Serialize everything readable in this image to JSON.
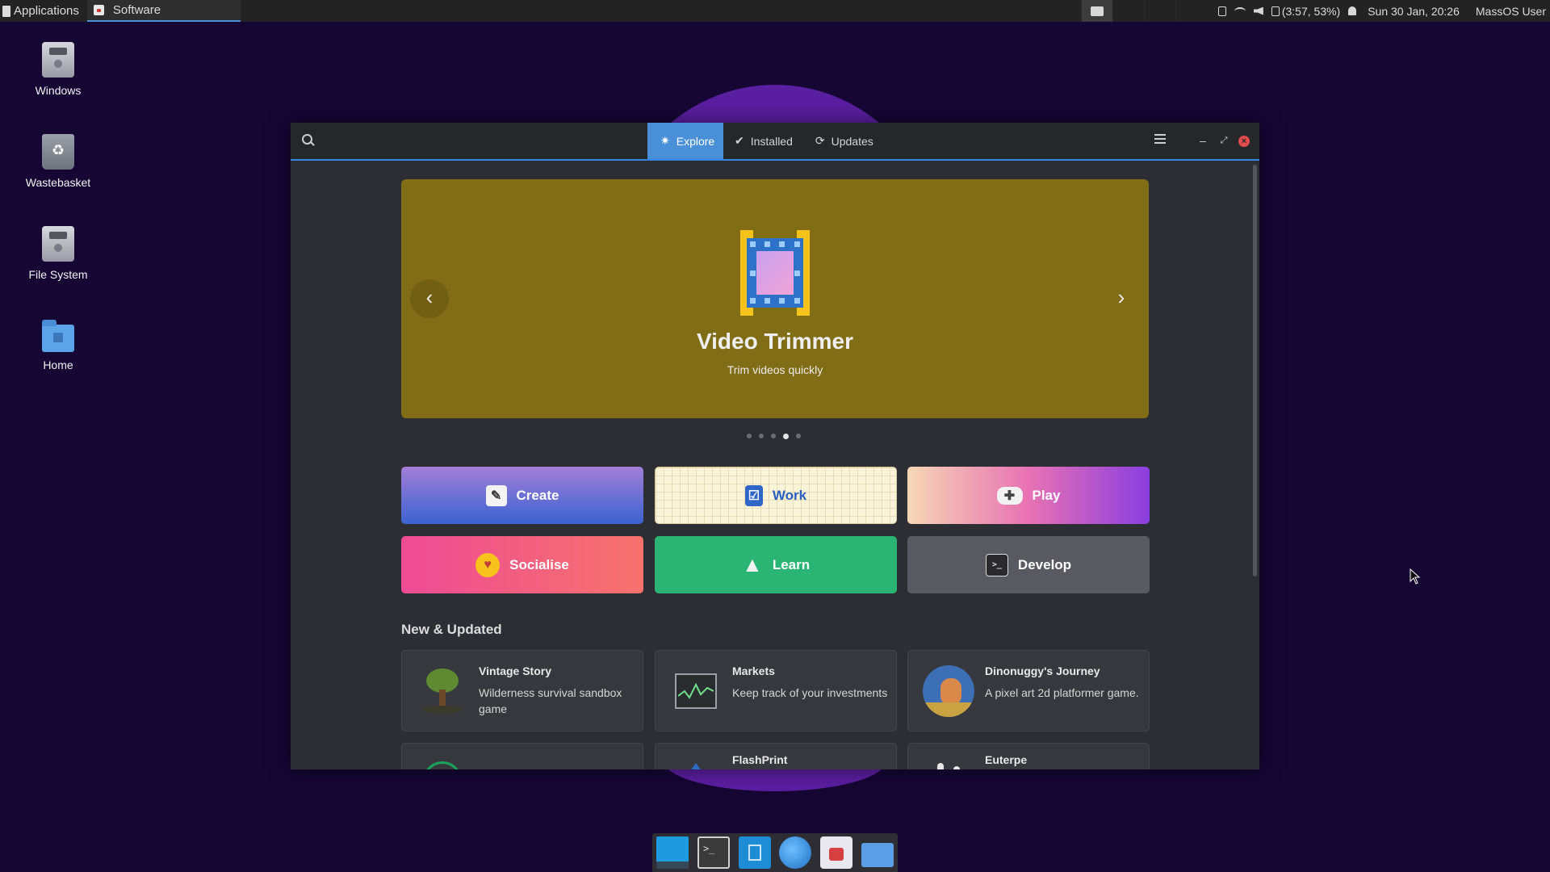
{
  "top_panel": {
    "applications_label": "Applications",
    "task_label": "Software",
    "battery_text": "(3:57, 53%)",
    "clock": "Sun 30 Jan, 20:26",
    "user": "MassOS User"
  },
  "desktop": {
    "icons": [
      {
        "label": "Windows",
        "icon": "drive-icon"
      },
      {
        "label": "Wastebasket",
        "icon": "trash-icon"
      },
      {
        "label": "File System",
        "icon": "drive-icon"
      },
      {
        "label": "Home",
        "icon": "folder-icon"
      }
    ]
  },
  "window": {
    "tabs": [
      {
        "label": "Explore",
        "icon": "explore-icon",
        "active": true
      },
      {
        "label": "Installed",
        "icon": "check-icon",
        "active": false
      },
      {
        "label": "Updates",
        "icon": "refresh-icon",
        "active": false
      }
    ],
    "hero": {
      "title": "Video Trimmer",
      "subtitle": "Trim videos quickly",
      "background": "#826d17",
      "page_count": 5,
      "active_page": 4
    },
    "categories": [
      {
        "label": "Create",
        "icon": "paint-icon"
      },
      {
        "label": "Work",
        "icon": "checklist-icon"
      },
      {
        "label": "Play",
        "icon": "gamepad-icon"
      },
      {
        "label": "Socialise",
        "icon": "smiley-icon"
      },
      {
        "label": "Learn",
        "icon": "paper-plane-icon"
      },
      {
        "label": "Develop",
        "icon": "terminal-icon"
      }
    ],
    "section_title": "New & Updated",
    "apps": [
      {
        "name": "Vintage Story",
        "desc": "Wilderness survival sandbox game"
      },
      {
        "name": "Markets",
        "desc": "Keep track of your investments"
      },
      {
        "name": "Dinonuggy's Journey",
        "desc": "A pixel art 2d platformer game."
      },
      {
        "name": "",
        "desc": ""
      },
      {
        "name": "FlashPrint",
        "desc": ""
      },
      {
        "name": "Euterpe",
        "desc": ""
      }
    ]
  },
  "colors": {
    "accent": "#4a90d9",
    "desktop_bg": "#150634",
    "close": "#e24b4b"
  }
}
